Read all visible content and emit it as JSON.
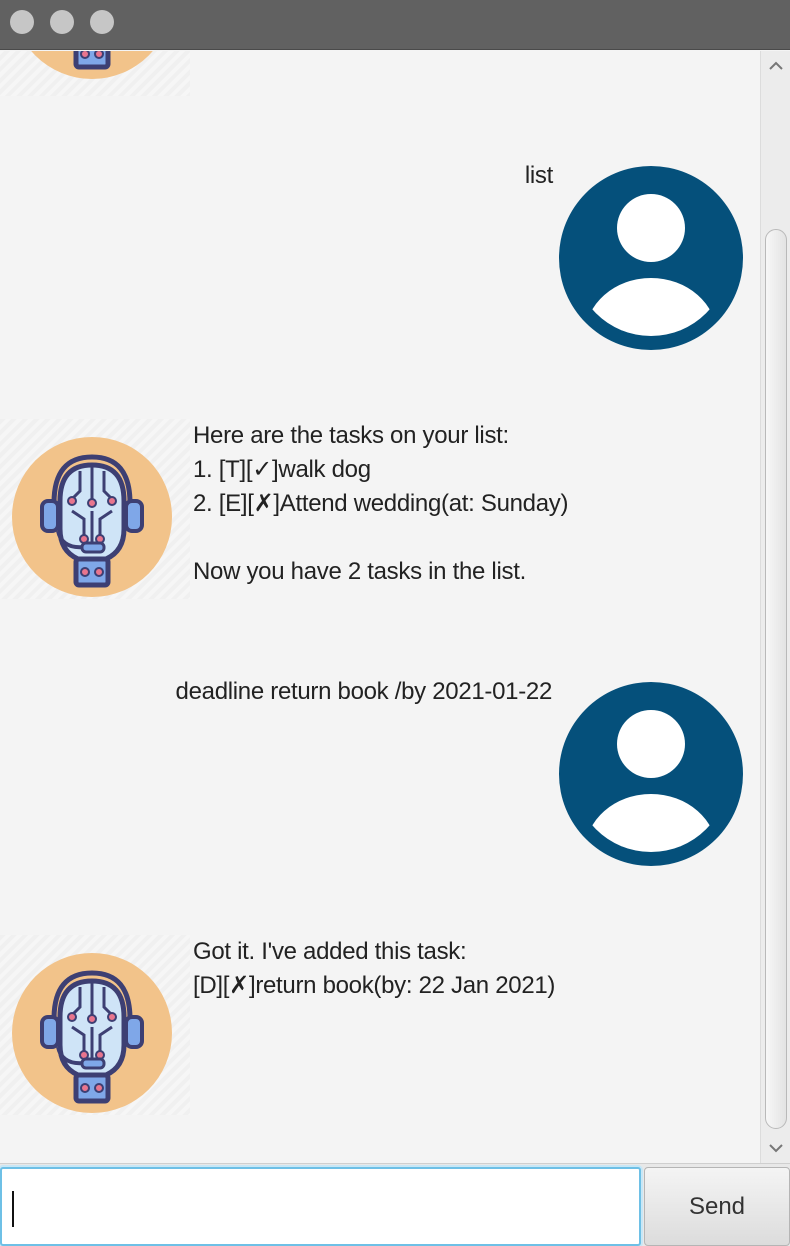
{
  "window": {
    "controls": [
      "close",
      "minimize",
      "zoom"
    ]
  },
  "conversation": {
    "user_msg_1": "list",
    "bot_msg_1": "Here are the tasks on your list:\n1. [T][✓]walk dog\n2. [E][✗]Attend wedding(at: Sunday)\n\nNow you have 2 tasks in the list.",
    "user_msg_2": "deadline return book /by 2021-01-22",
    "bot_msg_2": "Got it. I've added this task:\n[D][✗]return book(by: 22 Jan 2021)"
  },
  "input": {
    "value": "",
    "send_label": "Send"
  },
  "colors": {
    "user_avatar": "#05507b",
    "bot_avatar_bg": "#f2c38a",
    "robot_outline": "#3d3f73",
    "robot_face": "#cfe4f7",
    "accent_pink": "#e8758e"
  }
}
